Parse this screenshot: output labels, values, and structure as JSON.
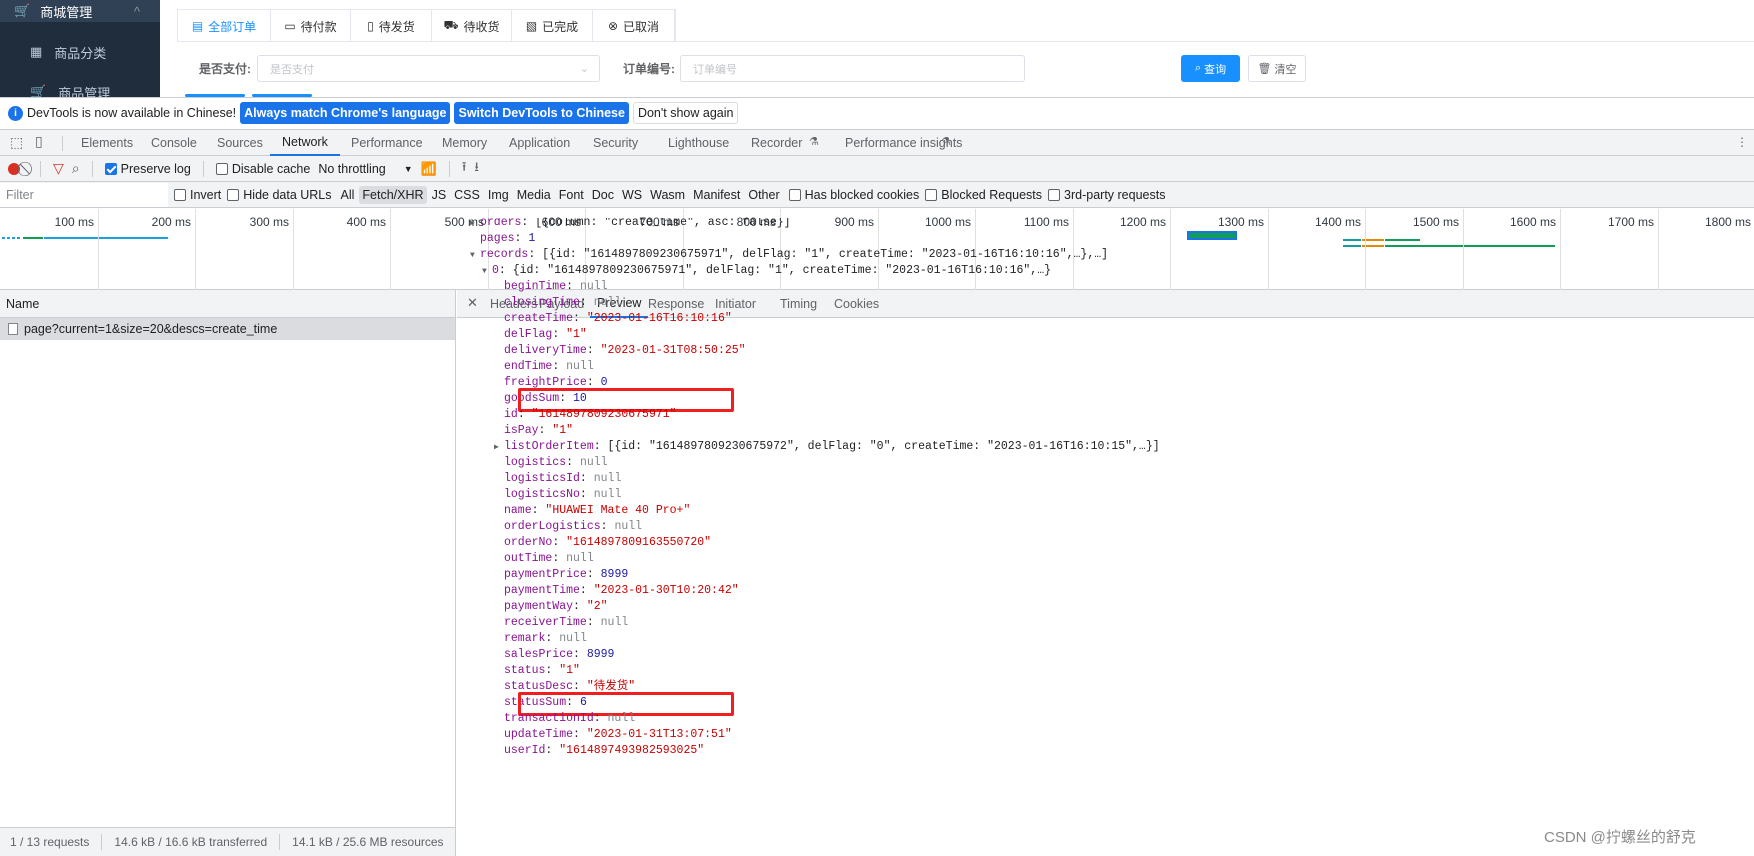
{
  "app": {
    "sidebar": {
      "section": "商城管理",
      "items": [
        "商品分类",
        "商品管理"
      ]
    },
    "order_tabs": [
      {
        "icon": "list-icon",
        "label": "全部订单"
      },
      {
        "icon": "wallet-icon",
        "label": "待付款"
      },
      {
        "icon": "box-icon",
        "label": "待发货"
      },
      {
        "icon": "truck-icon",
        "label": "待收货"
      },
      {
        "icon": "document-icon",
        "label": "已完成"
      },
      {
        "icon": "cancel-circle-icon",
        "label": "已取消"
      }
    ],
    "filters": {
      "pay_label": "是否支付:",
      "pay_placeholder": "是否支付",
      "order_label": "订单编号:",
      "order_placeholder": "订单编号"
    },
    "buttons": {
      "search": "查询",
      "clear": "清空"
    },
    "accent": "#1890ff"
  },
  "devtools": {
    "banner": {
      "text": "DevTools is now available in Chinese!",
      "btn1": "Always match Chrome's language",
      "btn2": "Switch DevTools to Chinese",
      "btn3": "Don't show again"
    },
    "tabs": [
      "Elements",
      "Console",
      "Sources",
      "Network",
      "Performance",
      "Memory",
      "Application",
      "Security",
      "Lighthouse",
      "Recorder",
      "Performance insights"
    ],
    "active_tab": "Network",
    "toolbar": {
      "preserve_log": "Preserve log",
      "preserve_log_checked": true,
      "disable_cache": "Disable cache",
      "throttling": "No throttling"
    },
    "filter": {
      "placeholder": "Filter",
      "invert": "Invert",
      "hide_data_urls": "Hide data URLs",
      "types": [
        "All",
        "Fetch/XHR",
        "JS",
        "CSS",
        "Img",
        "Media",
        "Font",
        "Doc",
        "WS",
        "Wasm",
        "Manifest",
        "Other"
      ],
      "active_type": "Fetch/XHR",
      "has_blocked_cookies": "Has blocked cookies",
      "blocked_requests": "Blocked Requests",
      "third_party": "3rd-party requests"
    },
    "timeline_ticks": [
      "100 ms",
      "200 ms",
      "300 ms",
      "400 ms",
      "500 ms",
      "600 ms",
      "700 ms",
      "800 ms",
      "900 ms",
      "1000 ms",
      "1100 ms",
      "1200 ms",
      "1300 ms",
      "1400 ms",
      "1500 ms",
      "1600 ms",
      "1700 ms",
      "1800 ms"
    ],
    "name_header": "Name",
    "requests": [
      "page?current=1&size=20&descs=create_time"
    ],
    "detail_tabs": [
      "Headers",
      "Payload",
      "Preview",
      "Response",
      "Initiator",
      "Timing",
      "Cookies"
    ],
    "active_detail_tab": "Preview",
    "status": {
      "requests": "1 / 13 requests",
      "transferred": "14.6 kB / 16.6 kB transferred",
      "resources": "14.1 kB / 25.6 MB resources"
    },
    "preview": [
      {
        "depth": 0,
        "arrow": "right",
        "key": "orders",
        "value": "[{column: \"create_time\", asc: false}]",
        "type": "p"
      },
      {
        "depth": 0,
        "key": "pages",
        "value": "1",
        "type": "n"
      },
      {
        "depth": 0,
        "arrow": "down",
        "key": "records",
        "value": "[{id: \"1614897809230675971\", delFlag: \"1\", createTime: \"2023-01-16T16:10:16\",…},…]",
        "type": "p"
      },
      {
        "depth": 1,
        "arrow": "down",
        "key": "0",
        "value": "{id: \"1614897809230675971\", delFlag: \"1\", createTime: \"2023-01-16T16:10:16\",…}",
        "type": "p"
      },
      {
        "depth": 2,
        "key": "beginTime",
        "value": "null",
        "type": "nl"
      },
      {
        "depth": 2,
        "key": "closingTime",
        "value": "null",
        "type": "nl"
      },
      {
        "depth": 2,
        "key": "createTime",
        "value": "\"2023-01-16T16:10:16\"",
        "type": "s"
      },
      {
        "depth": 2,
        "key": "delFlag",
        "value": "\"1\"",
        "type": "s"
      },
      {
        "depth": 2,
        "key": "deliveryTime",
        "value": "\"2023-01-31T08:50:25\"",
        "type": "s"
      },
      {
        "depth": 2,
        "key": "endTime",
        "value": "null",
        "type": "nl"
      },
      {
        "depth": 2,
        "key": "freightPrice",
        "value": "0",
        "type": "n"
      },
      {
        "depth": 2,
        "key": "goodsSum",
        "value": "10",
        "type": "n",
        "highlight": true
      },
      {
        "depth": 2,
        "key": "id",
        "value": "\"1614897809230675971\"",
        "type": "s"
      },
      {
        "depth": 2,
        "key": "isPay",
        "value": "\"1\"",
        "type": "s"
      },
      {
        "depth": 2,
        "arrow": "right",
        "key": "listOrderItem",
        "value": "[{id: \"1614897809230675972\", delFlag: \"0\", createTime: \"2023-01-16T16:10:15\",…}]",
        "type": "p"
      },
      {
        "depth": 2,
        "key": "logistics",
        "value": "null",
        "type": "nl"
      },
      {
        "depth": 2,
        "key": "logisticsId",
        "value": "null",
        "type": "nl"
      },
      {
        "depth": 2,
        "key": "logisticsNo",
        "value": "null",
        "type": "nl"
      },
      {
        "depth": 2,
        "key": "name",
        "value": "\"HUAWEI Mate 40 Pro+\"",
        "type": "s"
      },
      {
        "depth": 2,
        "key": "orderLogistics",
        "value": "null",
        "type": "nl"
      },
      {
        "depth": 2,
        "key": "orderNo",
        "value": "\"1614897809163550720\"",
        "type": "s"
      },
      {
        "depth": 2,
        "key": "outTime",
        "value": "null",
        "type": "nl"
      },
      {
        "depth": 2,
        "key": "paymentPrice",
        "value": "8999",
        "type": "n"
      },
      {
        "depth": 2,
        "key": "paymentTime",
        "value": "\"2023-01-30T10:20:42\"",
        "type": "s"
      },
      {
        "depth": 2,
        "key": "paymentWay",
        "value": "\"2\"",
        "type": "s"
      },
      {
        "depth": 2,
        "key": "receiverTime",
        "value": "null",
        "type": "nl"
      },
      {
        "depth": 2,
        "key": "remark",
        "value": "null",
        "type": "nl"
      },
      {
        "depth": 2,
        "key": "salesPrice",
        "value": "8999",
        "type": "n"
      },
      {
        "depth": 2,
        "key": "status",
        "value": "\"1\"",
        "type": "s"
      },
      {
        "depth": 2,
        "key": "statusDesc",
        "value": "\"待发货\"",
        "type": "s"
      },
      {
        "depth": 2,
        "key": "statusSum",
        "value": "6",
        "type": "n",
        "highlight": true
      },
      {
        "depth": 2,
        "key": "transactionId",
        "value": "null",
        "type": "nl"
      },
      {
        "depth": 2,
        "key": "updateTime",
        "value": "\"2023-01-31T13:07:51\"",
        "type": "s"
      },
      {
        "depth": 2,
        "key": "userId",
        "value": "\"1614897493982593025\"",
        "type": "s"
      }
    ]
  },
  "watermark": "CSDN @拧螺丝的舒克"
}
